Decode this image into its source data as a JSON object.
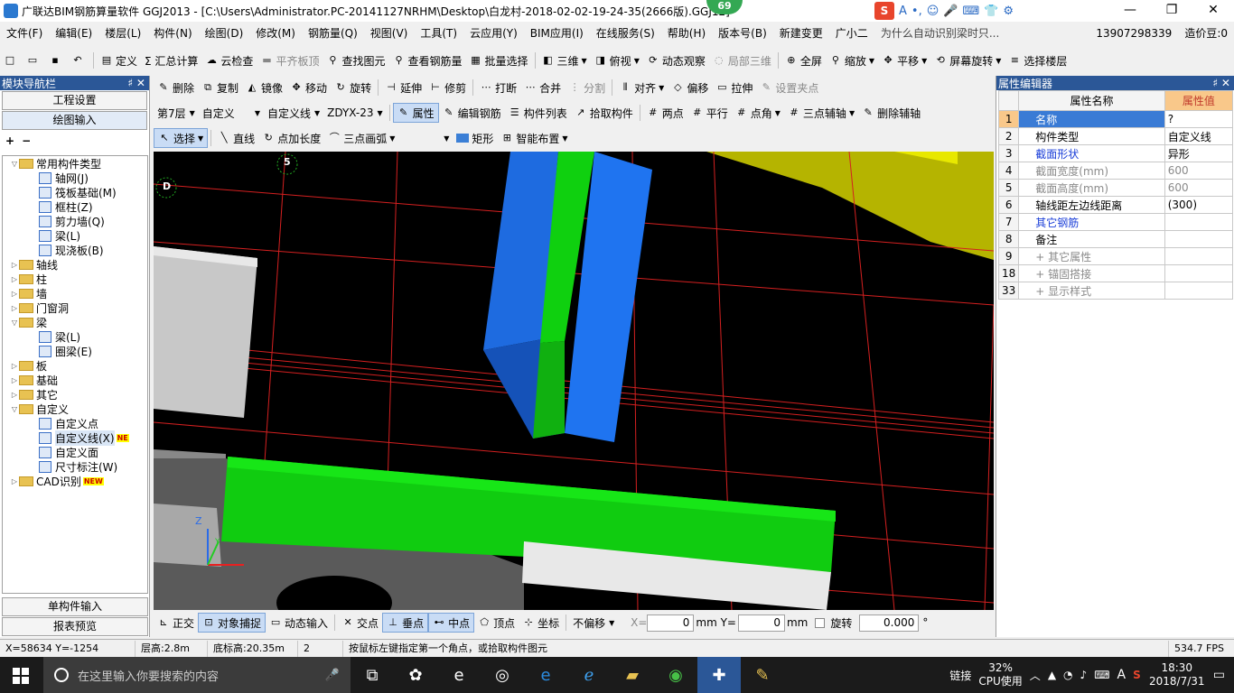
{
  "window": {
    "title": "广联达BIM钢筋算量软件 GGJ2013 - [C:\\Users\\Administrator.PC-20141127NRHM\\Desktop\\白龙村-2018-02-02-19-24-35(2666版).GGJ12]",
    "badge": "69",
    "controls": [
      "—",
      "❐",
      "✕"
    ]
  },
  "sogou": {
    "logo": "S",
    "items": [
      "A",
      "•,",
      "☺",
      "🎤",
      "⌨",
      "👕",
      "⚙"
    ]
  },
  "menu": {
    "items": [
      "文件(F)",
      "编辑(E)",
      "楼层(L)",
      "构件(N)",
      "绘图(D)",
      "修改(M)",
      "钢筋量(Q)",
      "视图(V)",
      "工具(T)",
      "云应用(Y)",
      "BIM应用(I)",
      "在线服务(S)",
      "帮助(H)",
      "版本号(B)",
      "新建变更",
      "广小二"
    ],
    "question": "为什么自动识别梁时只...",
    "phone": "13907298339",
    "price": "造价豆:0"
  },
  "toolbar1": [
    "定义",
    "Σ 汇总计算",
    "云检查",
    "平齐板顶",
    "查找图元",
    "查看钢筋量",
    "批量选择",
    "三维",
    "俯视",
    "动态观察",
    "局部三维",
    "全屏",
    "缩放",
    "平移",
    "屏幕旋转",
    "选择楼层"
  ],
  "toolbar2": [
    "删除",
    "复制",
    "镜像",
    "移动",
    "旋转",
    "延伸",
    "修剪",
    "打断",
    "合并",
    "分割",
    "对齐",
    "偏移",
    "拉伸",
    "设置夹点"
  ],
  "toolbar3": {
    "floor": "第7层",
    "category": "自定义",
    "type": "自定义线",
    "name": "ZDYX-23",
    "buttons": [
      "属性",
      "编辑钢筋",
      "构件列表",
      "拾取构件",
      "两点",
      "平行",
      "点角",
      "三点辅轴",
      "删除辅轴"
    ]
  },
  "toolbar4": [
    "选择",
    "直线",
    "点加长度",
    "三点画弧",
    "矩形",
    "智能布置"
  ],
  "nav": {
    "title": "模块导航栏",
    "pin": "♯ ✕",
    "top_buttons": [
      "工程设置",
      "绘图输入"
    ],
    "bottom_buttons": [
      "单构件输入",
      "报表预览"
    ],
    "tree": [
      {
        "label": "常用构件类型",
        "level": 0,
        "type": "folder",
        "open": true
      },
      {
        "label": "轴网(J)",
        "level": 1,
        "type": "item"
      },
      {
        "label": "筏板基础(M)",
        "level": 1,
        "type": "item"
      },
      {
        "label": "框柱(Z)",
        "level": 1,
        "type": "item"
      },
      {
        "label": "剪力墙(Q)",
        "level": 1,
        "type": "item"
      },
      {
        "label": "梁(L)",
        "level": 1,
        "type": "item"
      },
      {
        "label": "现浇板(B)",
        "level": 1,
        "type": "item"
      },
      {
        "label": "轴线",
        "level": 0,
        "type": "folder"
      },
      {
        "label": "柱",
        "level": 0,
        "type": "folder"
      },
      {
        "label": "墙",
        "level": 0,
        "type": "folder"
      },
      {
        "label": "门窗洞",
        "level": 0,
        "type": "folder"
      },
      {
        "label": "梁",
        "level": 0,
        "type": "folder",
        "open": true
      },
      {
        "label": "梁(L)",
        "level": 1,
        "type": "item"
      },
      {
        "label": "圈梁(E)",
        "level": 1,
        "type": "item"
      },
      {
        "label": "板",
        "level": 0,
        "type": "folder"
      },
      {
        "label": "基础",
        "level": 0,
        "type": "folder"
      },
      {
        "label": "其它",
        "level": 0,
        "type": "folder"
      },
      {
        "label": "自定义",
        "level": 0,
        "type": "folder",
        "open": true
      },
      {
        "label": "自定义点",
        "level": 1,
        "type": "item"
      },
      {
        "label": "自定义线(X)",
        "level": 1,
        "type": "item",
        "selected": true,
        "badge": "NE"
      },
      {
        "label": "自定义面",
        "level": 1,
        "type": "item"
      },
      {
        "label": "尺寸标注(W)",
        "level": 1,
        "type": "item"
      },
      {
        "label": "CAD识别",
        "level": 0,
        "type": "folder",
        "badge": "NEW"
      }
    ]
  },
  "viewport": {
    "axis_5": "5",
    "axis_d": "D",
    "axis_z": "Z",
    "axis_y": "Y"
  },
  "bottombar": {
    "buttons": [
      "正交",
      "对象捕捉",
      "动态输入",
      "交点",
      "垂点",
      "中点",
      "顶点",
      "坐标"
    ],
    "offset": "不偏移",
    "x_label": "X=",
    "x_value": "0",
    "y_label": "mm Y=",
    "y_value": "0",
    "unit": "mm",
    "rotate_label": "旋转",
    "rotate_value": "0.000",
    "degree": "°"
  },
  "status": {
    "coords": "X=58634 Y=-1254",
    "floor_height": "层高:2.8m",
    "base_height": "底标高:20.35m",
    "count": "2",
    "hint": "按鼠标左键指定第一个角点，或拾取构件图元",
    "fps": "534.7 FPS"
  },
  "props": {
    "title": "属性编辑器",
    "pin": "♯ ✕",
    "col_name": "属性名称",
    "col_value": "属性值",
    "rows": [
      {
        "num": "1",
        "name": "名称",
        "value": "?",
        "style": "blue"
      },
      {
        "num": "2",
        "name": "构件类型",
        "value": "自定义线",
        "style": "normal"
      },
      {
        "num": "3",
        "name": "截面形状",
        "value": "异形",
        "style": "blue"
      },
      {
        "num": "4",
        "name": "截面宽度(mm)",
        "value": "600",
        "style": "grey"
      },
      {
        "num": "5",
        "name": "截面高度(mm)",
        "value": "600",
        "style": "grey"
      },
      {
        "num": "6",
        "name": "轴线距左边线距离",
        "value": "(300)",
        "style": "normal"
      },
      {
        "num": "7",
        "name": "其它钢筋",
        "value": "",
        "style": "blue"
      },
      {
        "num": "8",
        "name": "备注",
        "value": "",
        "style": "normal"
      },
      {
        "num": "9",
        "name": "+ 其它属性",
        "value": "",
        "style": "grey"
      },
      {
        "num": "18",
        "name": "+ 锚固搭接",
        "value": "",
        "style": "grey"
      },
      {
        "num": "33",
        "name": "+ 显示样式",
        "value": "",
        "style": "grey"
      }
    ]
  },
  "taskbar": {
    "search_placeholder": "在这里输入你要搜索的内容",
    "cpu_percent": "32%",
    "cpu_label": "CPU使用",
    "link": "链接",
    "ime": "A",
    "time": "18:30",
    "date": "2018/7/31"
  }
}
